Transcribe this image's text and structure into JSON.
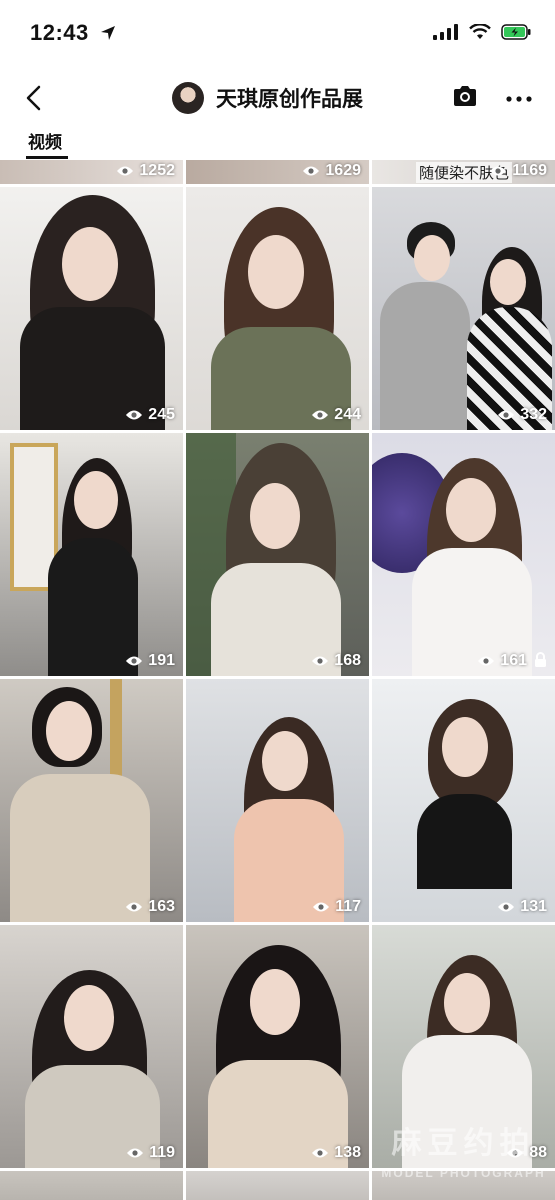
{
  "status_bar": {
    "time": "12:43"
  },
  "header": {
    "title": "天琪原创作品展"
  },
  "tabs": [
    {
      "label": "视频"
    }
  ],
  "top_row": {
    "counts": [
      "1252",
      "1629",
      "1169"
    ],
    "overlay_text": "随便染不肤色"
  },
  "videos": [
    {
      "count": "245"
    },
    {
      "count": "244"
    },
    {
      "count": "332"
    },
    {
      "count": "191"
    },
    {
      "count": "168"
    },
    {
      "count": "161"
    },
    {
      "count": "163"
    },
    {
      "count": "117"
    },
    {
      "count": "131"
    },
    {
      "count": "119"
    },
    {
      "count": "138"
    },
    {
      "count": "88"
    }
  ],
  "watermark": {
    "cn": "麻豆约拍",
    "en": "MODEL PHOTOGRAPH"
  },
  "colors": {
    "accent": "#111111",
    "battery": "#34c759"
  },
  "icons": [
    "back-icon",
    "camera-icon",
    "more-icon",
    "eye-icon",
    "lock-icon",
    "signal-icon",
    "wifi-icon",
    "battery-icon",
    "location-arrow-icon"
  ]
}
